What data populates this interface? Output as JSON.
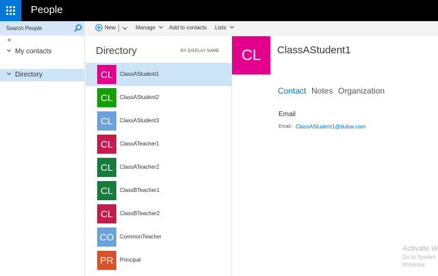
{
  "app": {
    "title": "People"
  },
  "search": {
    "placeholder": "Search People"
  },
  "nav": {
    "collapse_glyph": "«",
    "my_contacts": "My contacts",
    "directory": "Directory"
  },
  "toolbar": {
    "new_label": "New",
    "manage_label": "Manage",
    "add_to_contacts_label": "Add to contacts",
    "lists_label": "Lists"
  },
  "list": {
    "title": "Directory",
    "sort_label": "BY DISPLAY NAME",
    "items": [
      {
        "initials": "CL",
        "name": "ClassAStudent1",
        "color": "#e3008c",
        "selected": true
      },
      {
        "initials": "CL",
        "name": "ClassAStudent2",
        "color": "#10a000"
      },
      {
        "initials": "CL",
        "name": "ClassAStudent3",
        "color": "#6ca2dc"
      },
      {
        "initials": "CL",
        "name": "ClassATeacher1",
        "color": "#c41b4c"
      },
      {
        "initials": "CL",
        "name": "ClassATeacher2",
        "color": "#177b3c"
      },
      {
        "initials": "CL",
        "name": "ClassBTeacher1",
        "color": "#177b3c"
      },
      {
        "initials": "CL",
        "name": "ClassBTeacher2",
        "color": "#c41b4c"
      },
      {
        "initials": "CO",
        "name": "CommonTeacher",
        "color": "#6ca2dc"
      },
      {
        "initials": "PR",
        "name": "Principal",
        "color": "#d9532a"
      }
    ]
  },
  "detail": {
    "initials": "CL",
    "name": "ClassAStudent1",
    "avatar_color": "#e3008c",
    "tabs": [
      "Contact",
      "Notes",
      "Organization"
    ],
    "active_tab": "Contact",
    "section_title": "Email",
    "email_label": "Email:",
    "email": "ClassAStudent1@dubai.com"
  },
  "watermark": {
    "line1": "Activate Wi",
    "line2": "Go to System",
    "line3": "Windows."
  },
  "colors": {
    "accent": "#0078d7",
    "link": "#0072c6",
    "selection": "#cde3f6",
    "search_bg": "#d4e6f7"
  }
}
